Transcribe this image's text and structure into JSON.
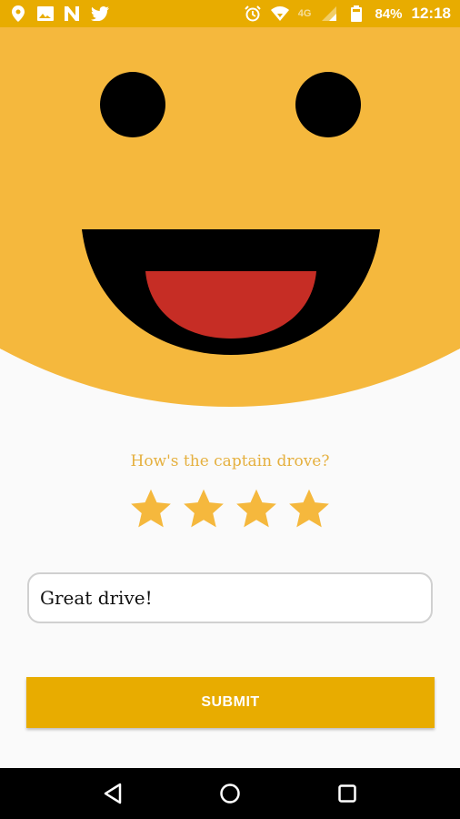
{
  "status_bar": {
    "left_icons": [
      "location-icon",
      "image-icon",
      "n-app-icon",
      "twitter-icon"
    ],
    "right_icons": [
      "alarm-icon",
      "wifi-icon",
      "signal-icon",
      "battery-icon"
    ],
    "network_label": "4G",
    "battery": "84%",
    "time": "12:18",
    "background_color": "#e8ac00"
  },
  "face": {
    "skin_color": "#f5b83d",
    "eye_color": "#000000",
    "mouth_color": "#000000",
    "tongue_color": "#c62d25"
  },
  "rating": {
    "question": "How's the captain drove?",
    "star_color": "#f5b83d",
    "stars_filled": 4,
    "stars_shown": 4
  },
  "comment": {
    "value": "Great drive!",
    "placeholder": ""
  },
  "submit": {
    "label": "SUBMIT",
    "color": "#e8ac00"
  },
  "nav_bar": {
    "buttons": [
      "back-icon",
      "home-icon",
      "recents-icon"
    ]
  }
}
